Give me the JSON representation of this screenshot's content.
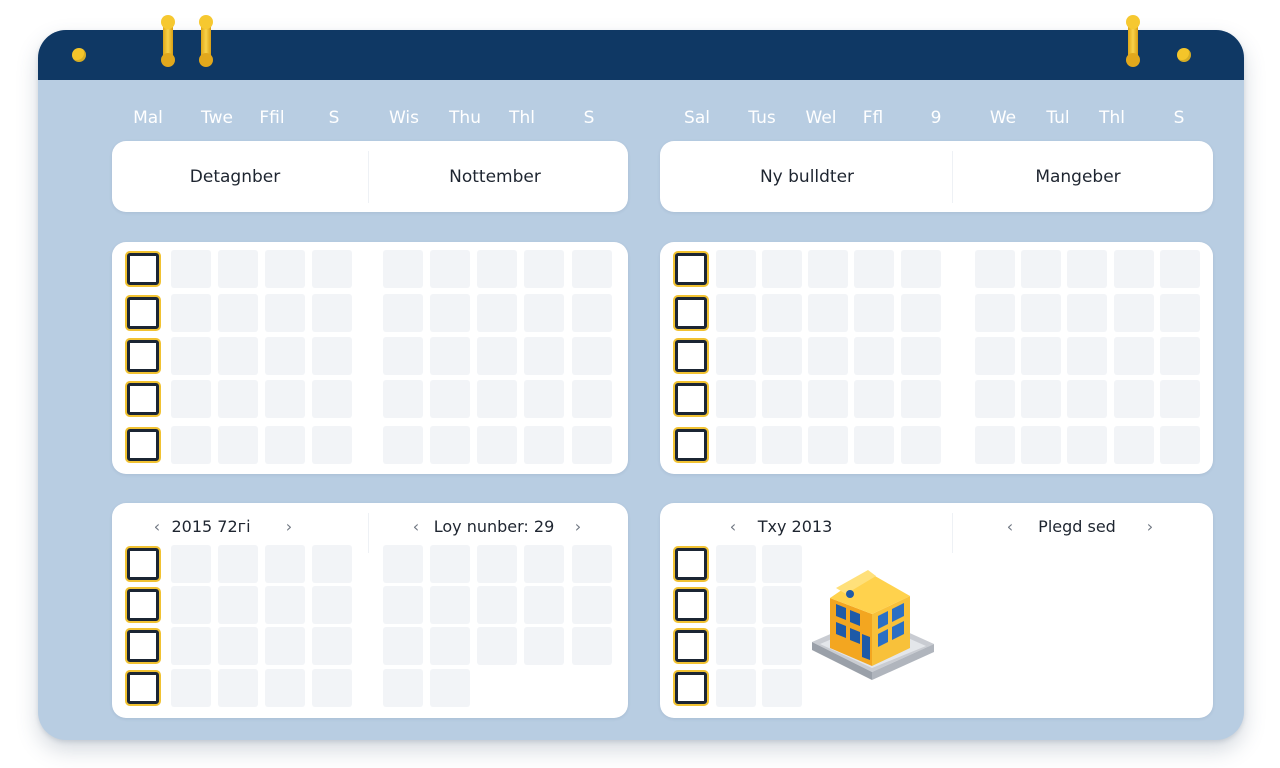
{
  "header": {
    "day_labels": [
      "Mal",
      "Twe",
      "Ffil",
      "S",
      "Wis",
      "Thu",
      "Thl",
      "S",
      "Sal",
      "Tus",
      "Wel",
      "Ffl",
      "9",
      "We",
      "Tul",
      "Thl",
      "S"
    ]
  },
  "months": {
    "left_a": "Detagnber",
    "left_b": "Nottember",
    "right_a": "Ny bulldter",
    "right_b": "Mangeber"
  },
  "navigation": {
    "left_a": "2015 72гі",
    "left_b": "Loy nunber: 29",
    "right_a": "Txy 2013",
    "right_b": "Plegd sed",
    "prev_glyph": "‹",
    "next_glyph": "›"
  },
  "icons": {
    "building": "building-icon"
  },
  "colors": {
    "board": "#b8cde2",
    "topbar": "#0f3864",
    "accent_gold": "#f4c52a",
    "cell": "#f2f4f7",
    "checkbox_border": "#1b2533"
  }
}
